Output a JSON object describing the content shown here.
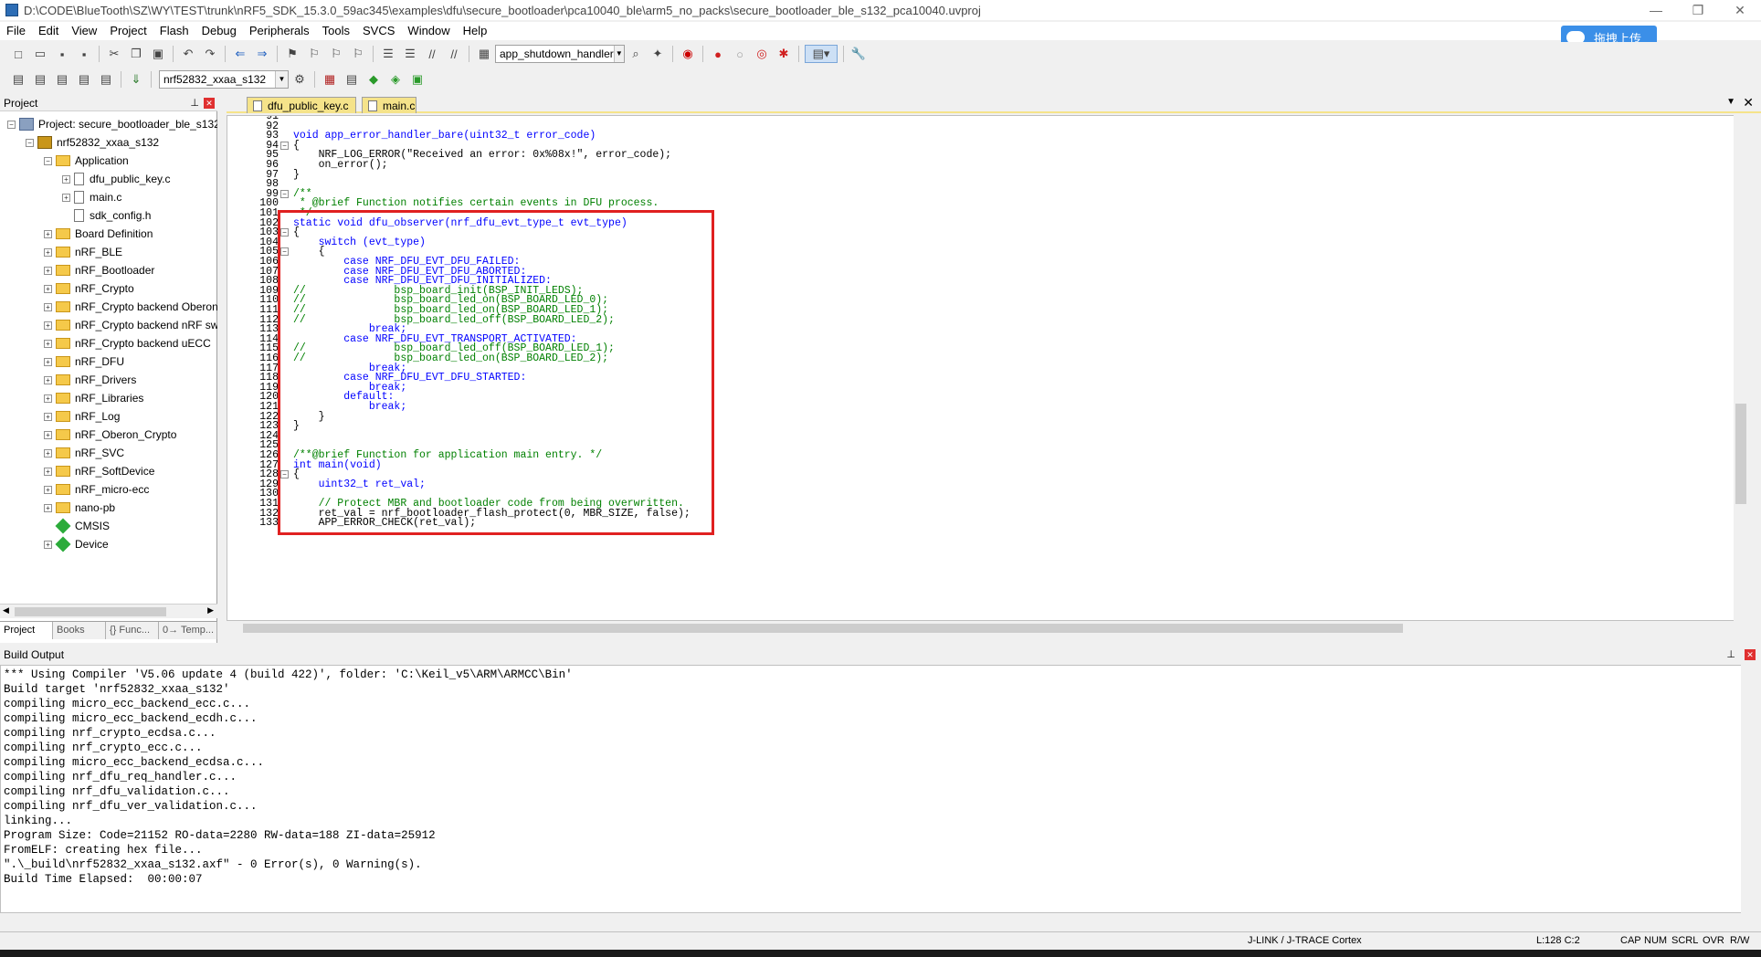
{
  "window": {
    "title": "D:\\CODE\\BlueTooth\\SZ\\WY\\TEST\\trunk\\nRF5_SDK_15.3.0_59ac345\\examples\\dfu\\secure_bootloader\\pca10040_ble\\arm5_no_packs\\secure_bootloader_ble_s132_pca10040.uvproj",
    "minimize": "—",
    "maximize": "❐",
    "close": "✕"
  },
  "menu": [
    "File",
    "Edit",
    "View",
    "Project",
    "Flash",
    "Debug",
    "Peripherals",
    "Tools",
    "SVCS",
    "Window",
    "Help"
  ],
  "toolbar": {
    "function_combo": "app_shutdown_handler",
    "target_combo": "nrf52832_xxaa_s132",
    "upload_label": "拖拽上传"
  },
  "project_panel": {
    "title": "Project",
    "tree": [
      {
        "label": "Project: secure_bootloader_ble_s132_",
        "level": 0,
        "type": "project",
        "exp": "−"
      },
      {
        "label": "nrf52832_xxaa_s132",
        "level": 1,
        "type": "target",
        "exp": "−"
      },
      {
        "label": "Application",
        "level": 2,
        "type": "folder",
        "exp": "−"
      },
      {
        "label": "dfu_public_key.c",
        "level": 3,
        "type": "file",
        "exp": "+"
      },
      {
        "label": "main.c",
        "level": 3,
        "type": "file",
        "exp": "+"
      },
      {
        "label": "sdk_config.h",
        "level": 3,
        "type": "file",
        "exp": ""
      },
      {
        "label": "Board Definition",
        "level": 2,
        "type": "folder",
        "exp": "+"
      },
      {
        "label": "nRF_BLE",
        "level": 2,
        "type": "folder",
        "exp": "+"
      },
      {
        "label": "nRF_Bootloader",
        "level": 2,
        "type": "folder",
        "exp": "+"
      },
      {
        "label": "nRF_Crypto",
        "level": 2,
        "type": "folder",
        "exp": "+"
      },
      {
        "label": "nRF_Crypto backend Oberon",
        "level": 2,
        "type": "folder",
        "exp": "+"
      },
      {
        "label": "nRF_Crypto backend nRF sw",
        "level": 2,
        "type": "folder",
        "exp": "+"
      },
      {
        "label": "nRF_Crypto backend uECC",
        "level": 2,
        "type": "folder",
        "exp": "+"
      },
      {
        "label": "nRF_DFU",
        "level": 2,
        "type": "folder",
        "exp": "+"
      },
      {
        "label": "nRF_Drivers",
        "level": 2,
        "type": "folder",
        "exp": "+"
      },
      {
        "label": "nRF_Libraries",
        "level": 2,
        "type": "folder",
        "exp": "+"
      },
      {
        "label": "nRF_Log",
        "level": 2,
        "type": "folder",
        "exp": "+"
      },
      {
        "label": "nRF_Oberon_Crypto",
        "level": 2,
        "type": "folder",
        "exp": "+"
      },
      {
        "label": "nRF_SVC",
        "level": 2,
        "type": "folder",
        "exp": "+"
      },
      {
        "label": "nRF_SoftDevice",
        "level": 2,
        "type": "folder",
        "exp": "+"
      },
      {
        "label": "nRF_micro-ecc",
        "level": 2,
        "type": "folder",
        "exp": "+"
      },
      {
        "label": "nano-pb",
        "level": 2,
        "type": "folder",
        "exp": "+"
      },
      {
        "label": "CMSIS",
        "level": 2,
        "type": "gem",
        "exp": ""
      },
      {
        "label": "Device",
        "level": 2,
        "type": "gem",
        "exp": "+"
      }
    ],
    "tabs": [
      "Project",
      "Books",
      "{} Func...",
      "0→ Temp..."
    ]
  },
  "editor": {
    "tabs": [
      "dfu_public_key.c",
      "main.c"
    ],
    "active_tab": "main.c",
    "lines": [
      {
        "n": "91",
        "t": "",
        "fold": ""
      },
      {
        "n": "92",
        "t": "",
        "fold": ""
      },
      {
        "n": "93",
        "t": "void app_error_handler_bare(uint32_t error_code)",
        "fold": ""
      },
      {
        "n": "94",
        "t": "{",
        "fold": "−"
      },
      {
        "n": "95",
        "t": "    NRF_LOG_ERROR(\"Received an error: 0x%08x!\", error_code);",
        "fold": ""
      },
      {
        "n": "96",
        "t": "    on_error();",
        "fold": ""
      },
      {
        "n": "97",
        "t": "}",
        "fold": ""
      },
      {
        "n": "98",
        "t": "",
        "fold": ""
      },
      {
        "n": "99",
        "t": "/**",
        "fold": "−"
      },
      {
        "n": "100",
        "t": " * @brief Function notifies certain events in DFU process.",
        "fold": ""
      },
      {
        "n": "101",
        "t": " */",
        "fold": ""
      },
      {
        "n": "102",
        "t": "static void dfu_observer(nrf_dfu_evt_type_t evt_type)",
        "fold": ""
      },
      {
        "n": "103",
        "t": "{",
        "fold": "−"
      },
      {
        "n": "104",
        "t": "    switch (evt_type)",
        "fold": ""
      },
      {
        "n": "105",
        "t": "    {",
        "fold": "−"
      },
      {
        "n": "106",
        "t": "        case NRF_DFU_EVT_DFU_FAILED:",
        "fold": ""
      },
      {
        "n": "107",
        "t": "        case NRF_DFU_EVT_DFU_ABORTED:",
        "fold": ""
      },
      {
        "n": "108",
        "t": "        case NRF_DFU_EVT_DFU_INITIALIZED:",
        "fold": ""
      },
      {
        "n": "109",
        "t": "//              bsp_board_init(BSP_INIT_LEDS);",
        "fold": ""
      },
      {
        "n": "110",
        "t": "//              bsp_board_led_on(BSP_BOARD_LED_0);",
        "fold": ""
      },
      {
        "n": "111",
        "t": "//              bsp_board_led_on(BSP_BOARD_LED_1);",
        "fold": ""
      },
      {
        "n": "112",
        "t": "//              bsp_board_led_off(BSP_BOARD_LED_2);",
        "fold": ""
      },
      {
        "n": "113",
        "t": "            break;",
        "fold": ""
      },
      {
        "n": "114",
        "t": "        case NRF_DFU_EVT_TRANSPORT_ACTIVATED:",
        "fold": ""
      },
      {
        "n": "115",
        "t": "//              bsp_board_led_off(BSP_BOARD_LED_1);",
        "fold": ""
      },
      {
        "n": "116",
        "t": "//              bsp_board_led_on(BSP_BOARD_LED_2);",
        "fold": ""
      },
      {
        "n": "117",
        "t": "            break;",
        "fold": ""
      },
      {
        "n": "118",
        "t": "        case NRF_DFU_EVT_DFU_STARTED:",
        "fold": ""
      },
      {
        "n": "119",
        "t": "            break;",
        "fold": ""
      },
      {
        "n": "120",
        "t": "        default:",
        "fold": ""
      },
      {
        "n": "121",
        "t": "            break;",
        "fold": ""
      },
      {
        "n": "122",
        "t": "    }",
        "fold": ""
      },
      {
        "n": "123",
        "t": "}",
        "fold": ""
      },
      {
        "n": "124",
        "t": "",
        "fold": ""
      },
      {
        "n": "125",
        "t": "",
        "fold": ""
      },
      {
        "n": "126",
        "t": "/**@brief Function for application main entry. */",
        "fold": ""
      },
      {
        "n": "127",
        "t": "int main(void)",
        "fold": ""
      },
      {
        "n": "128",
        "t": "{",
        "fold": "−"
      },
      {
        "n": "129",
        "t": "    uint32_t ret_val;",
        "fold": ""
      },
      {
        "n": "130",
        "t": "",
        "fold": ""
      },
      {
        "n": "131",
        "t": "    // Protect MBR and bootloader code from being overwritten.",
        "fold": ""
      },
      {
        "n": "132",
        "t": "    ret_val = nrf_bootloader_flash_protect(0, MBR_SIZE, false);",
        "fold": ""
      },
      {
        "n": "133",
        "t": "    APP_ERROR_CHECK(ret_val);",
        "fold": ""
      }
    ]
  },
  "build_output": {
    "title": "Build Output",
    "lines": [
      "*** Using Compiler 'V5.06 update 4 (build 422)', folder: 'C:\\Keil_v5\\ARM\\ARMCC\\Bin'",
      "Build target 'nrf52832_xxaa_s132'",
      "compiling micro_ecc_backend_ecc.c...",
      "compiling micro_ecc_backend_ecdh.c...",
      "compiling nrf_crypto_ecdsa.c...",
      "compiling nrf_crypto_ecc.c...",
      "compiling micro_ecc_backend_ecdsa.c...",
      "compiling nrf_dfu_req_handler.c...",
      "compiling nrf_dfu_validation.c...",
      "compiling nrf_dfu_ver_validation.c...",
      "linking...",
      "Program Size: Code=21152 RO-data=2280 RW-data=188 ZI-data=25912",
      "FromELF: creating hex file...",
      "\".\\_build\\nrf52832_xxaa_s132.axf\" - 0 Error(s), 0 Warning(s).",
      "Build Time Elapsed:  00:00:07"
    ]
  },
  "status": {
    "debugger": "J-LINK / J-TRACE Cortex",
    "position": "L:128 C:2",
    "cap": "CAP",
    "num": "NUM",
    "scrl": "SCRL",
    "ovr": "OVR",
    "rw": "R/W"
  }
}
